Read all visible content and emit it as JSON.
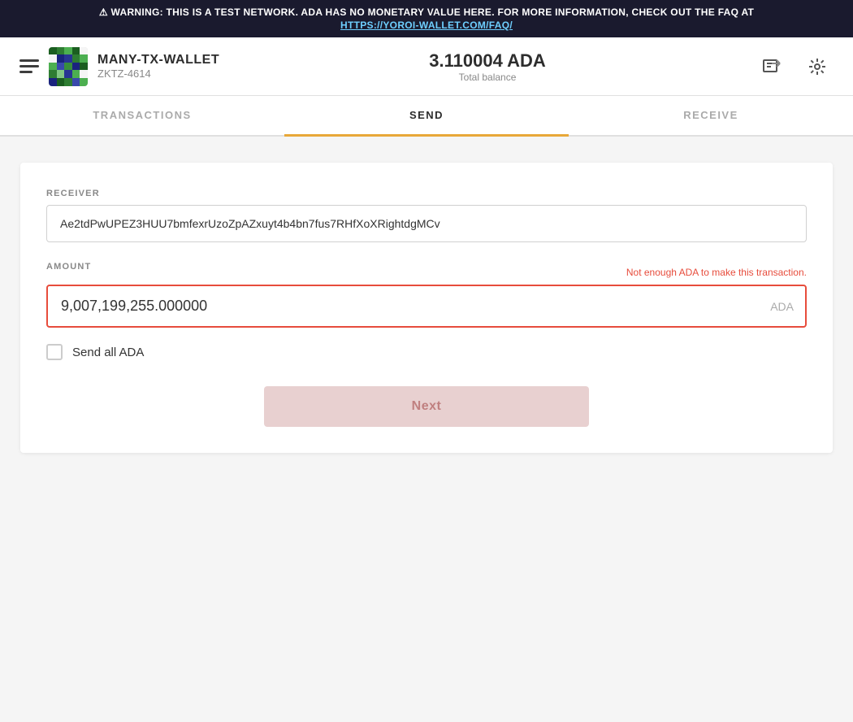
{
  "warning": {
    "text": "⚠ WARNING: THIS IS A TEST NETWORK. ADA HAS NO MONETARY VALUE HERE. FOR MORE INFORMATION, CHECK OUT THE FAQ AT",
    "link_text": "HTTPS://YOROI-WALLET.COM/FAQ/",
    "link_url": "https://yoroi-wallet.com/faq/"
  },
  "header": {
    "wallet_name": "MANY-TX-WALLET",
    "wallet_id": "ZKTZ-4614",
    "balance_amount": "3.110004 ADA",
    "balance_label": "Total balance"
  },
  "nav": {
    "tabs": [
      {
        "id": "transactions",
        "label": "TRANSACTIONS"
      },
      {
        "id": "send",
        "label": "SEND"
      },
      {
        "id": "receive",
        "label": "RECEIVE"
      }
    ],
    "active_tab": "send"
  },
  "send_form": {
    "receiver_label": "RECEIVER",
    "receiver_placeholder": "",
    "receiver_value": "Ae2tdPwUPEZ3HUU7bmfexrUzoZpAZxuyt4b4bn7fus7RHfXoXRightdgMCv",
    "amount_label": "AMOUNT",
    "amount_error": "Not enough ADA to make this transaction.",
    "amount_value": "9,007,199,255.000000",
    "amount_currency": "ADA",
    "send_all_label": "Send all ADA",
    "next_button_label": "Next"
  }
}
